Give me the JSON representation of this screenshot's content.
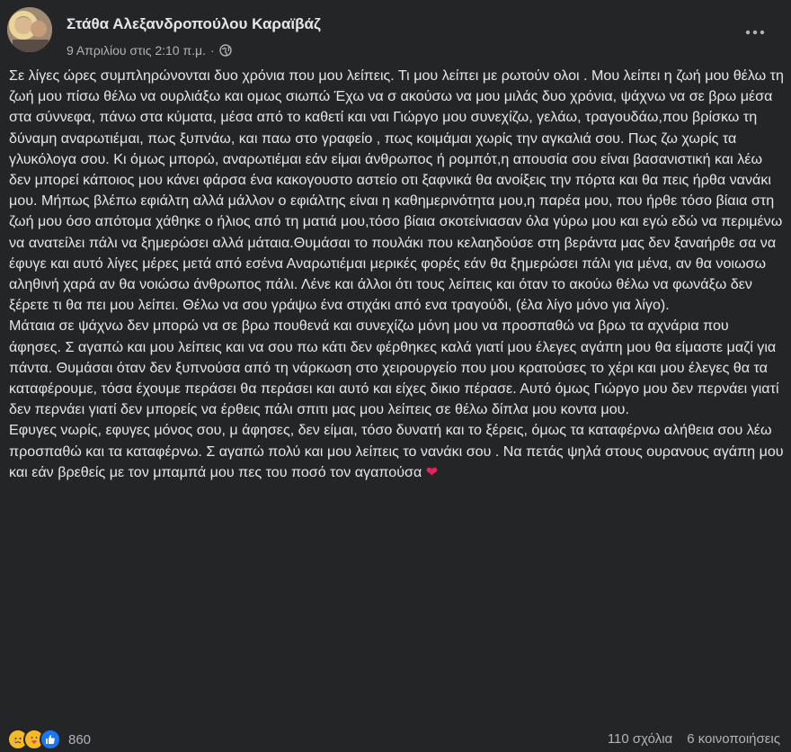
{
  "author": "Στάθα Αλεξανδροπούλου Καραϊβάζ",
  "timestamp": "9 Απριλίου στις 2:10 π.μ.",
  "meta_separator": "·",
  "privacy_icon": "globe-icon",
  "more_icon": "more-icon",
  "paragraphs": [
    "Σε λίγες ώρες συμπληρώνονται δυο χρόνια που μου λείπεις. Τι μου λείπει με ρωτούν  ολοι . Μου λείπει η ζωή μου θέλω τη ζωή μου πίσω θέλω να ουρλιάξω και ομως σιωπώ Έχω να σ ακούσω να μου μιλάς δυο χρόνια, ψάχνω να σε βρω μέσα στα σύννεφα, πάνω στα κύματα, μέσα από το καθετί και ναι Γιώργο μου συνεχίζω, γελάω, τραγουδάω,που βρίσκω τη δύναμη αναρωτιέμαι, πως ξυπνάω, και παω στο γραφείο , πως κοιμάμαι χωρίς την αγκαλιά σου. Πως ζω χωρίς τα γλυκόλογα σου. Κι όμως μπορώ, αναρωτιέμαι εάν είμαι άνθρωπος ή ρομπότ,η απουσία σου είναι βασανιστική και λέω δεν μπορεί κάποιος μου κάνει φάρσα ένα κακογουστο αστείο οτι ξαφνικά θα ανοίξεις την πόρτα και θα πεις ήρθα νανάκι μου. Μήπως βλέπω εφιάλτη αλλά μάλλον ο εφιάλτης είναι η καθημερινότητα μου,η παρέα μου, που ήρθε τόσο βίαια στη ζωή μου όσο απότομα χάθηκε ο ήλιος από τη ματιά μου,τόσο βίαια σκοτείνιασαν όλα γύρω μου και εγώ εδώ να περιμένω να ανατείλει πάλι να ξημερώσει αλλά μάταια.Θυμάσαι το πουλάκι που κελαηδούσε στη βεράντα μας δεν ξαναήρθε σα να έφυγε και αυτό λίγες μέρες μετά από εσένα Αναρωτιέμαι μερικές φορές εάν θα ξημερώσει πάλι για μένα, αν θα νοιωσω αληθινή χαρά αν θα νοιώσω άνθρωπος πάλι. Λένε και άλλοι ότι τους λείπεις και όταν το ακούω θέλω να φωνάξω δεν ξέρετε τι θα πει μου λείπει. Θέλω να σου γράψω ένα στιχάκι από ενα τραγούδι, (έλα λίγο μόνο για λίγο).",
    "Μάταια σε ψάχνω δεν μπορώ να σε βρω πουθενά και συνεχίζω μόνη μου να προσπαθώ να βρω τα αχνάρια που άφησες. Σ αγαπώ και μου λείπεις και να σου πω κάτι δεν φέρθηκες καλά γιατί μου έλεγες αγάπη μου θα είμαστε μαζί για πάντα. Θυμάσαι όταν δεν ξυπνούσα από τη νάρκωση στο χειρουργείο που μου κρατούσες το χέρι και μου έλεγες θα τα καταφέρουμε, τόσα έχουμε περάσει θα περάσει και αυτό και είχες δικιο πέρασε. Αυτό όμως Γιώργο μου δεν περνάει γιατί δεν περνάει γιατί δεν μπορείς να έρθεις πάλι σπιτι μας μου λείπεις σε θέλω δίπλα μου κοντα μου.",
    "Εφυγες νωρίς, εφυγες μόνος σου, μ άφησες, δεν είμαι, τόσο δυνατή και το ξέρεις, όμως τα καταφέρνω αλήθεια σου λέω προσπαθώ και τα καταφέρνω. Σ αγαπώ πολύ και μου λείπεις το νανάκι σου  . Να πετάς ψηλά στους ουρανους αγάπη μου και εάν βρεθείς με τον μπαμπά μου πες του ποσό τον αγαπούσα"
  ],
  "heart_emoji": "❤",
  "reactions": {
    "icons": [
      "sad-reaction-icon",
      "care-reaction-icon",
      "like-reaction-icon"
    ],
    "count": "860"
  },
  "comments": "110 σχόλια",
  "shares": "6 κοινοποιήσεις",
  "colors": {
    "background": "#242526",
    "text": "#e4e6eb",
    "secondary": "#b0b3b8",
    "like": "#1877f2",
    "heart": "#e0245e"
  }
}
